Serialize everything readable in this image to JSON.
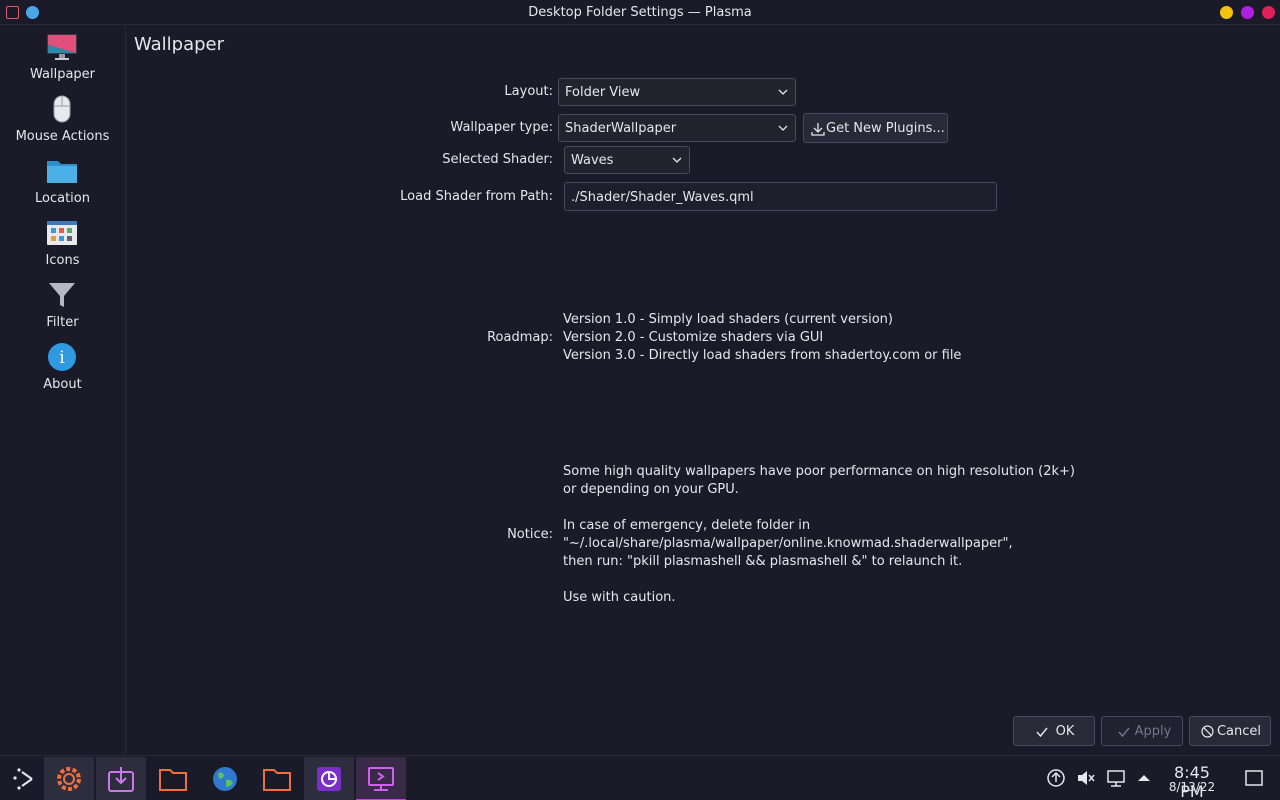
{
  "window": {
    "title": "Desktop Folder Settings — Plasma"
  },
  "sidebar": {
    "items": [
      {
        "label": "Wallpaper",
        "icon": "monitor-icon"
      },
      {
        "label": "Mouse Actions",
        "icon": "mouse-icon"
      },
      {
        "label": "Location",
        "icon": "folder-icon"
      },
      {
        "label": "Icons",
        "icon": "icons-icon"
      },
      {
        "label": "Filter",
        "icon": "filter-icon"
      },
      {
        "label": "About",
        "icon": "info-icon"
      }
    ]
  },
  "page": {
    "title": "Wallpaper"
  },
  "form": {
    "layout_label": "Layout:",
    "layout_value": "Folder View",
    "wallpaper_type_label": "Wallpaper type:",
    "wallpaper_type_value": "ShaderWallpaper",
    "get_plugins_label": "Get New Plugins...",
    "selected_shader_label": "Selected Shader:",
    "selected_shader_value": "Waves",
    "load_path_label": "Load Shader from Path:",
    "load_path_value": "./Shader/Shader_Waves.qml",
    "roadmap_label": "Roadmap:",
    "roadmap_lines": [
      "Version 1.0 - Simply load shaders (current version)",
      "Version 2.0 - Customize shaders via GUI",
      "Version 3.0 - Directly load shaders from shadertoy.com or file"
    ],
    "notice_label": "Notice:",
    "notice_lines": [
      "Some high quality wallpapers have poor performance on high resolution (2k+)",
      "or depending on your GPU.",
      "",
      "In case of emergency, delete folder in",
      "\"~/.local/share/plasma/wallpaper/online.knowmad.shaderwallpaper\",",
      "then run: \"pkill plasmashell && plasmashell &\" to relaunch it.",
      "",
      "Use with caution."
    ]
  },
  "buttons": {
    "ok": "OK",
    "apply": "Apply",
    "cancel": "Cancel"
  },
  "taskbar": {
    "clock_time": "8:45 PM",
    "clock_date": "8/13/22"
  },
  "colors": {
    "background": "#1b1a29",
    "accent_magenta": "#c340e0",
    "accent_blue": "#4aa8e8",
    "orange": "#f0703a"
  }
}
